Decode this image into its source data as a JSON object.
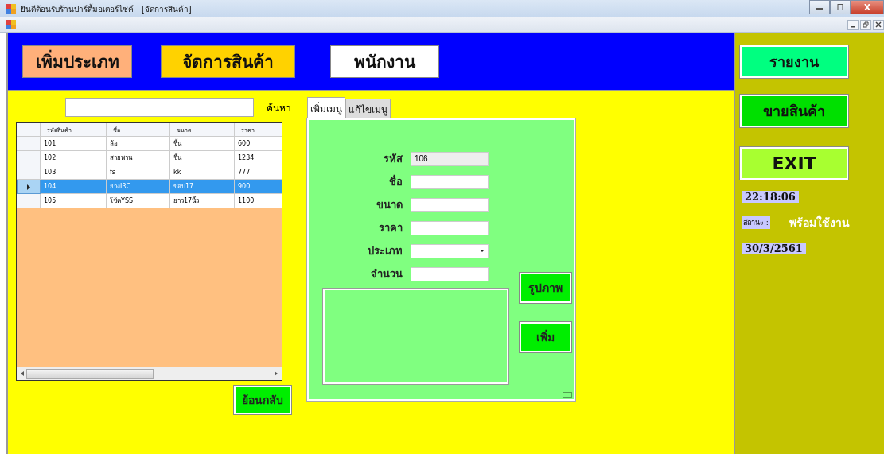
{
  "window": {
    "title": "ยินดีต้อนรับร้านปาร์ตี้มอเตอร์ไซค์ - [จัดการสินค้า]"
  },
  "nav_buttons": [
    {
      "label": "เพิ่มประเภท",
      "color": "#ffb07a"
    },
    {
      "label": "จัดการสินค้า",
      "color": "#ffd200"
    },
    {
      "label": "พนักงาน",
      "color": "#ffffff"
    }
  ],
  "search": {
    "label": "ค้นหา"
  },
  "table": {
    "columns": [
      "รหัสสินค้า",
      "ชื่อ",
      "ขนาด",
      "ราคา"
    ],
    "rows": [
      {
        "cells": [
          "101",
          "ล้อ",
          "ชิ้น",
          "600"
        ],
        "selected": false
      },
      {
        "cells": [
          "102",
          "สายพาน",
          "ชิ้น",
          "1234"
        ],
        "selected": false
      },
      {
        "cells": [
          "103",
          "fs",
          "kk",
          "777"
        ],
        "selected": false
      },
      {
        "cells": [
          "104",
          "ยางIRC",
          "ขอบ17",
          "900"
        ],
        "selected": true
      },
      {
        "cells": [
          "105",
          "โช้คYSS",
          "ยาว17นิ้ว",
          "1100"
        ],
        "selected": false
      }
    ]
  },
  "back_button": "ย้อนกลับ",
  "tabs": [
    {
      "label": "เพิ่มเมนู",
      "selected": true
    },
    {
      "label": "แก้ไขเมนู",
      "selected": false
    }
  ],
  "form": {
    "fields": [
      {
        "label": "รหัส",
        "kind": "readonly",
        "value": "106"
      },
      {
        "label": "ชื่อ",
        "kind": "text"
      },
      {
        "label": "ขนาด",
        "kind": "text"
      },
      {
        "label": "ราคา",
        "kind": "text"
      },
      {
        "label": "ประเภท",
        "kind": "select"
      },
      {
        "label": "จำนวน",
        "kind": "text"
      }
    ],
    "image_button": "รูปภาพ",
    "add_button": "เพิ่ม"
  },
  "side_buttons": [
    {
      "label": "รายงาน",
      "color": "#00ff80"
    },
    {
      "label": "ขายสินค้า",
      "color": "#00e000"
    },
    {
      "label": "EXIT",
      "color": "#a8ff30"
    }
  ],
  "clock": "22:18:06",
  "status": {
    "label": "สถานะ :",
    "value": "พร้อมใช้งาน"
  },
  "date": "30/3/2561"
}
